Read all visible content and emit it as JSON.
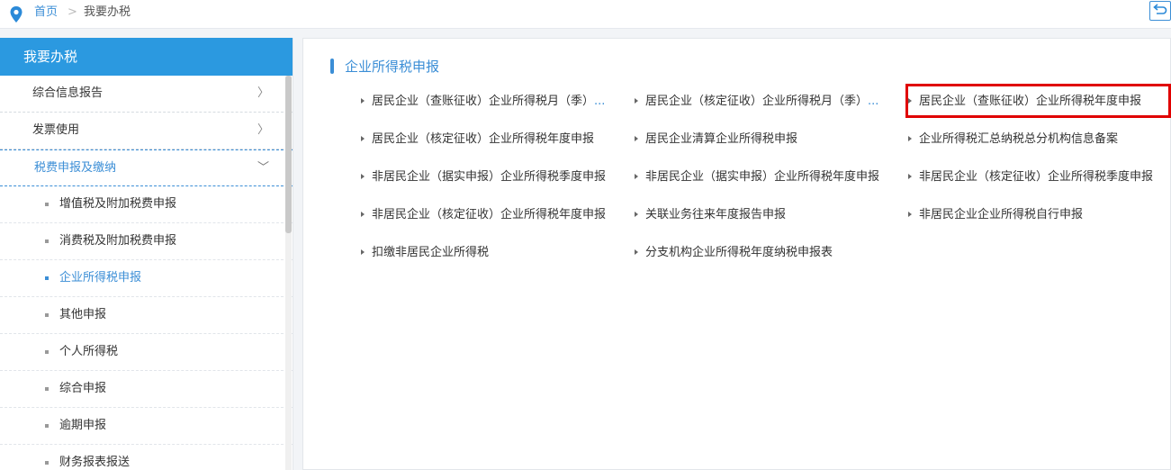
{
  "breadcrumb": {
    "home": "首页",
    "separator": ">",
    "current": "我要办税"
  },
  "icons": {
    "pin": "location-pin-icon",
    "back": "return-arrow-icon"
  },
  "colors": {
    "accent": "#3b8ed6",
    "header": "#2b99e0",
    "highlight": "#e00000"
  },
  "sidebar": {
    "title": "我要办税",
    "items": [
      {
        "label": "综合信息报告",
        "chevron": "〉"
      },
      {
        "label": "发票使用",
        "chevron": "〉"
      },
      {
        "label": "税费申报及缴纳",
        "chevron": "﹀"
      }
    ],
    "subitems": [
      {
        "label": "增值税及附加税费申报"
      },
      {
        "label": "消费税及附加税费申报"
      },
      {
        "label": "企业所得税申报"
      },
      {
        "label": "其他申报"
      },
      {
        "label": "个人所得税"
      },
      {
        "label": "综合申报"
      },
      {
        "label": "逾期申报"
      },
      {
        "label": "财务报表报送"
      }
    ]
  },
  "main": {
    "section_title": "企业所得税申报",
    "links": [
      {
        "text": "居民企业（查账征收）企业所得税月（季）",
        "more": "..."
      },
      {
        "text": "居民企业（核定征收）企业所得税月（季）",
        "more": "..."
      },
      {
        "text": "居民企业（查账征收）企业所得税年度申报",
        "more": ""
      },
      {
        "text": "居民企业（核定征收）企业所得税年度申报",
        "more": ""
      },
      {
        "text": "居民企业清算企业所得税申报",
        "more": ""
      },
      {
        "text": "企业所得税汇总纳税总分机构信息备案",
        "more": ""
      },
      {
        "text": "非居民企业（据实申报）企业所得税季度申报",
        "more": ""
      },
      {
        "text": "非居民企业（据实申报）企业所得税年度申报",
        "more": ""
      },
      {
        "text": "非居民企业（核定征收）企业所得税季度申报",
        "more": ""
      },
      {
        "text": "非居民企业（核定征收）企业所得税年度申报",
        "more": ""
      },
      {
        "text": "关联业务往来年度报告申报",
        "more": ""
      },
      {
        "text": "非居民企业企业所得税自行申报",
        "more": ""
      },
      {
        "text": "扣缴非居民企业所得税",
        "more": ""
      },
      {
        "text": "分支机构企业所得税年度纳税申报表",
        "more": ""
      }
    ]
  }
}
